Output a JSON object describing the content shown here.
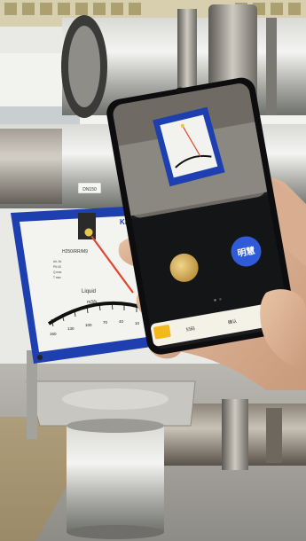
{
  "meter": {
    "brand": "KROH",
    "model": "H250/RR/M9",
    "scale_unit_top": "%",
    "medium": "Liquid",
    "unit": "m3/h",
    "scale_ticks": [
      "160",
      "130",
      "100",
      "70",
      "40",
      "10"
    ]
  },
  "phone": {
    "capture_button_label": "明慧",
    "bottom_tabs": [
      "扫码",
      "确认"
    ]
  },
  "pipe_tag": "DN150"
}
